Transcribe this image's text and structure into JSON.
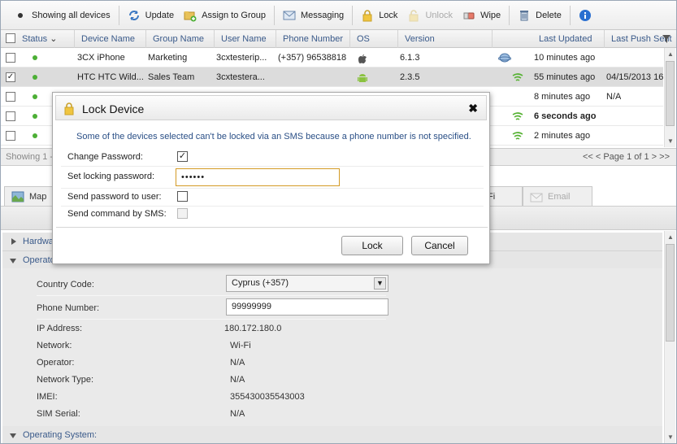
{
  "toolbar": {
    "showing_all": "Showing all devices",
    "update": "Update",
    "assign_group": "Assign to Group",
    "messaging": "Messaging",
    "lock": "Lock",
    "unlock": "Unlock",
    "wipe": "Wipe",
    "delete": "Delete"
  },
  "grid": {
    "columns": [
      "Status",
      "Device Name",
      "Group Name",
      "User Name",
      "Phone Number",
      "OS",
      "Version",
      "Last Updated",
      "Last Push Sent"
    ],
    "rows": [
      {
        "device": "3CX iPhone",
        "group": "Marketing",
        "user": "3cxtesterip...",
        "phone": "(+357) 96538818",
        "os": "apple",
        "version": "6.1.3",
        "net": "globe",
        "updated": "10 minutes ago",
        "push": "",
        "checked": false,
        "selected": false
      },
      {
        "device": "HTC HTC Wild...",
        "group": "Sales Team",
        "user": "3cxtestera...",
        "phone": "",
        "os": "android",
        "version": "2.3.5",
        "net": "wifi",
        "updated": "55 minutes ago",
        "push": "04/15/2013 16",
        "checked": true,
        "selected": true
      },
      {
        "device": "",
        "group": "",
        "user": "",
        "phone": "",
        "os": "",
        "version": "",
        "net": "",
        "updated": "8 minutes ago",
        "push": "N/A",
        "checked": false,
        "selected": false
      },
      {
        "device": "",
        "group": "",
        "user": "",
        "phone": "",
        "os": "",
        "version": "",
        "net": "wifi",
        "updated": "6 seconds ago",
        "push": "",
        "checked": false,
        "selected": false
      },
      {
        "device": "",
        "group": "",
        "user": "",
        "phone": "",
        "os": "",
        "version": "",
        "net": "wifi",
        "updated": "2 minutes ago",
        "push": "",
        "checked": false,
        "selected": false
      }
    ],
    "footer_left": "Showing 1 -",
    "paging": "<< <  Page 1 of 1  > >>"
  },
  "tabs": {
    "map": "Map",
    "wifi": "Fi",
    "email": "Email"
  },
  "sections": {
    "hardware": "Hardware",
    "operator": "Operator",
    "operating_system": "Operating System:"
  },
  "details": {
    "country_code_label": "Country Code:",
    "country_code_value": "Cyprus (+357)",
    "phone_label": "Phone Number:",
    "phone_value": "99999999",
    "ip_label": "IP Address:",
    "ip_value": "180.172.180.0",
    "network_label": "Network:",
    "network_value": "Wi-Fi",
    "operator_label": "Operator:",
    "operator_value": "N/A",
    "network_type_label": "Network Type:",
    "network_type_value": "N/A",
    "imei_label": "IMEI:",
    "imei_value": "355430035543003",
    "sim_label": "SIM Serial:",
    "sim_value": "N/A"
  },
  "modal": {
    "title": "Lock Device",
    "message": "Some of the devices selected can't be locked via an SMS because a phone number is not specified.",
    "change_password_label": "Change Password:",
    "change_password_checked": true,
    "set_password_label": "Set locking password:",
    "password_value": "••••••",
    "send_password_label": "Send password to user:",
    "send_sms_label": "Send command by SMS:",
    "lock_button": "Lock",
    "cancel_button": "Cancel"
  },
  "colors": {
    "accent_blue": "#3a5a8a",
    "status_green": "#4caf35",
    "input_focus": "#d39a25"
  }
}
